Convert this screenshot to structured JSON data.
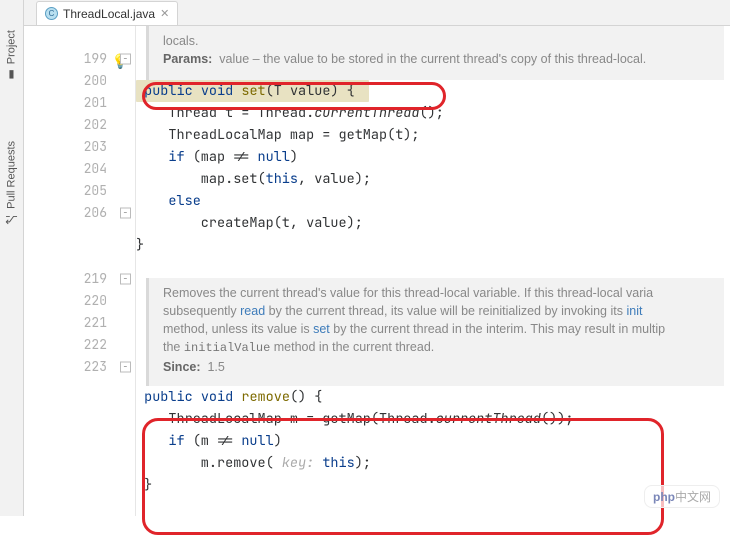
{
  "sidebar": {
    "items": [
      {
        "label": "Project",
        "icon": "folder-icon"
      },
      {
        "label": "Pull Requests",
        "icon": "pr-icon"
      }
    ]
  },
  "tab": {
    "label": "ThreadLocal.java",
    "icon_letter": "C"
  },
  "doc_top": {
    "line0": "locals.",
    "params_label": "Params:",
    "params_text": "value – the value to be stored in the current thread's copy of this thread-local."
  },
  "code_set": {
    "l199": {
      "indent": "",
      "kw1": "public",
      "kw2": "void",
      "name": "set",
      "sig": "(T value) {"
    },
    "l200": "    Thread t = Thread.currentThread();",
    "l201": "    ThreadLocalMap map = getMap(t);",
    "l202_a": "    ",
    "l202_kw": "if",
    "l202_b": " (map != ",
    "l202_null": "null",
    "l202_c": ")",
    "l203_a": "        map.set(",
    "l203_kw": "this",
    "l203_b": ", value);",
    "l204_kw": "else",
    "l205": "        createMap(t, value);",
    "l206": "}"
  },
  "doc_mid": {
    "t1": "Removes the current thread's value for this thread-local variable. If this thread-local varia",
    "t2a": "subsequently ",
    "t2link": "read",
    "t2b": " by the current thread, its value will be reinitialized by invoking its ",
    "t2link2": "init",
    "t3a": "method, unless its value is ",
    "t3link": "set",
    "t3b": " by the current thread in the interim. This may result in multip",
    "t4a": "the ",
    "t4code": "initialValue",
    "t4b": " method in the current thread.",
    "since_label": "Since:",
    "since_val": "1.5"
  },
  "code_remove": {
    "l219": {
      "kw1": "public",
      "kw2": "void",
      "name": "remove",
      "sig": "() {"
    },
    "l220a": "    ThreadLocalMap m = getMap(Thread.",
    "l220b": "currentThread",
    "l220c": "());",
    "l221_a": "    ",
    "l221_kw": "if",
    "l221_b": " (m != ",
    "l221_null": "null",
    "l221_c": ")",
    "l222_a": "        m.remove( ",
    "l222_hint": "key:",
    "l222_kw": "this",
    "l222_b": ");",
    "l223": "}"
  },
  "line_numbers": [
    "199",
    "200",
    "201",
    "202",
    "203",
    "204",
    "205",
    "206",
    "",
    "219",
    "220",
    "221",
    "222",
    "223"
  ],
  "watermark": {
    "a": "php",
    "b": "中文网"
  }
}
